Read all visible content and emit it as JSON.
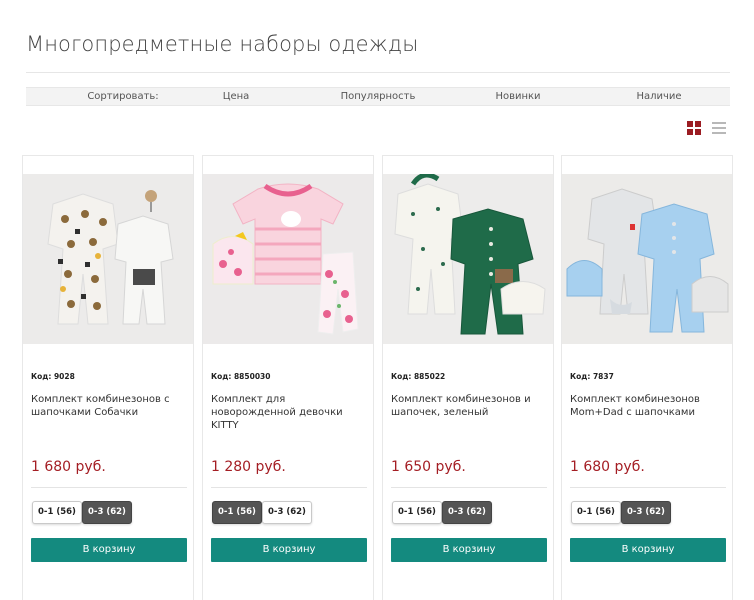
{
  "page": {
    "title": "Многопредметные наборы одежды"
  },
  "sort": {
    "label": "Сортировать:",
    "options": [
      "Цена",
      "Популярность",
      "Новинки",
      "Наличие"
    ]
  },
  "colors": {
    "accent": "#9b1c22",
    "price": "#a41e24",
    "cart_button": "#148a7f",
    "selected_size": "#555555"
  },
  "view_icons": [
    "grid-view-icon",
    "list-view-icon"
  ],
  "products": [
    {
      "code": "Код: 9028",
      "name": "Комплект комбинезонов с шапочками Собачки",
      "price": "1 680 руб.",
      "sizes": [
        {
          "label": "0-1 (56)",
          "selected": false
        },
        {
          "label": "0-3 (62)",
          "selected": true
        }
      ],
      "cart": "В корзину"
    },
    {
      "code": "Код: 8850030",
      "name": "Комплект для новорожденной девочки KITTY",
      "price": "1 280 руб.",
      "sizes": [
        {
          "label": "0-1 (56)",
          "selected": true
        },
        {
          "label": "0-3 (62)",
          "selected": false
        }
      ],
      "cart": "В корзину"
    },
    {
      "code": "Код: 885022",
      "name": "Комплект комбинезонов и шапочек, зеленый",
      "price": "1 650 руб.",
      "sizes": [
        {
          "label": "0-1 (56)",
          "selected": false
        },
        {
          "label": "0-3 (62)",
          "selected": true
        }
      ],
      "cart": "В корзину"
    },
    {
      "code": "Код: 7837",
      "name": "Комплект комбинезонов Mom+Dad с шапочками",
      "price": "1 680 руб.",
      "sizes": [
        {
          "label": "0-1 (56)",
          "selected": false
        },
        {
          "label": "0-3 (62)",
          "selected": true
        }
      ],
      "cart": "В корзину"
    }
  ]
}
